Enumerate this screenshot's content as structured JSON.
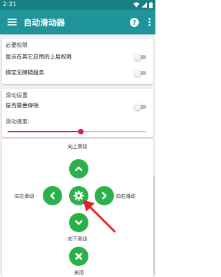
{
  "status_bar": {
    "time": "2:21"
  },
  "app_bar": {
    "title": "自动滑动器",
    "menu_icon": "menu-icon",
    "help_icon": "help-icon",
    "more_icon": "more-vert-icon"
  },
  "permissions": {
    "title": "必要权限",
    "overlay_label": "显示在其它应用的上层权限",
    "overlay_enabled": false,
    "accessibility_label": "绑定无障碍服务",
    "accessibility_enabled": false
  },
  "slide_settings": {
    "title": "滑动设置",
    "pause_label": "是否需要停顿",
    "pause_enabled": false,
    "speed_label": "滑动速度:",
    "speed_value": 0.53
  },
  "control_pad": {
    "up_label": "向上滑动",
    "left_label": "向左滑动",
    "right_label": "向右滑动",
    "down_label": "向下滑动",
    "close_label": "关闭"
  },
  "colors": {
    "app_bar": "#1f959b",
    "status_bar": "#1a7f85",
    "accent": "#e01a57",
    "control_green": "#2bb14a",
    "arrow_red": "#e0202a"
  }
}
